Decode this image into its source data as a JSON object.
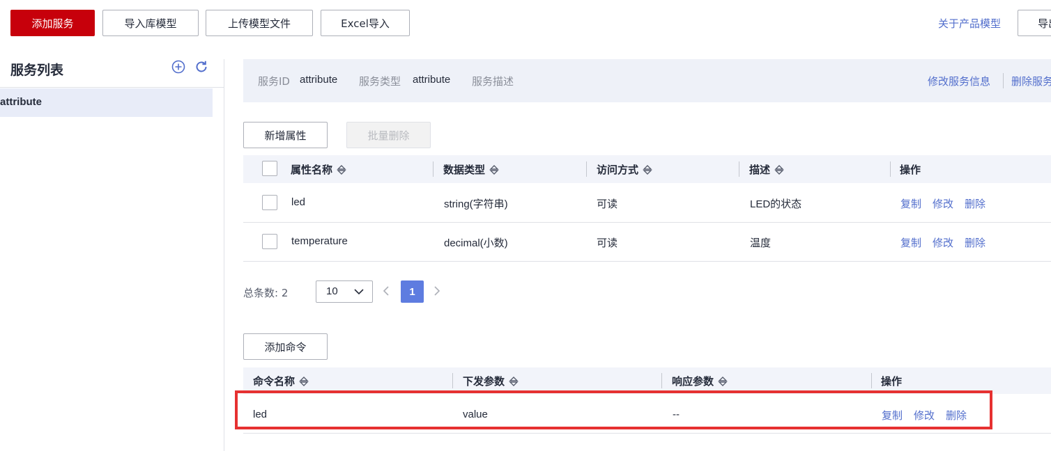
{
  "toolbar": {
    "add_service": "添加服务",
    "import_model": "导入库模型",
    "upload_model": "上传模型文件",
    "excel_import": "Excel导入",
    "about_model": "关于产品模型",
    "export_partial": "导出"
  },
  "service_list": {
    "title": "服务列表",
    "items": [
      {
        "label": "attribute"
      }
    ],
    "icons": [
      "add-circle-icon",
      "refresh-icon"
    ]
  },
  "service_info": {
    "id_label": "服务ID",
    "id_value": "attribute",
    "type_label": "服务类型",
    "type_value": "attribute",
    "desc_label": "服务描述",
    "edit_link": "修改服务信息",
    "delete_link": "删除服务"
  },
  "properties": {
    "add_button": "新增属性",
    "batch_delete_button": "批量删除",
    "columns": [
      "属性名称",
      "数据类型",
      "访问方式",
      "描述",
      "操作"
    ],
    "rows": [
      {
        "name": "led",
        "type": "string(字符串)",
        "access": "可读",
        "desc": "LED的状态"
      },
      {
        "name": "temperature",
        "type": "decimal(小数)",
        "access": "可读",
        "desc": "温度"
      }
    ],
    "ops": {
      "copy": "复制",
      "edit": "修改",
      "delete": "删除"
    }
  },
  "pagination": {
    "total_label": "总条数:",
    "total": "2",
    "page_size": "10",
    "current_page": "1"
  },
  "commands": {
    "add_button": "添加命令",
    "columns": [
      "命令名称",
      "下发参数",
      "响应参数",
      "操作"
    ],
    "rows": [
      {
        "name": "led",
        "params": "value",
        "response": "--"
      }
    ],
    "ops": {
      "copy": "复制",
      "edit": "修改",
      "delete": "删除"
    }
  },
  "colors": {
    "primary": "#c7000b",
    "link": "#526ecc",
    "highlight": "#e63131",
    "active_page": "#5e7ce0"
  }
}
